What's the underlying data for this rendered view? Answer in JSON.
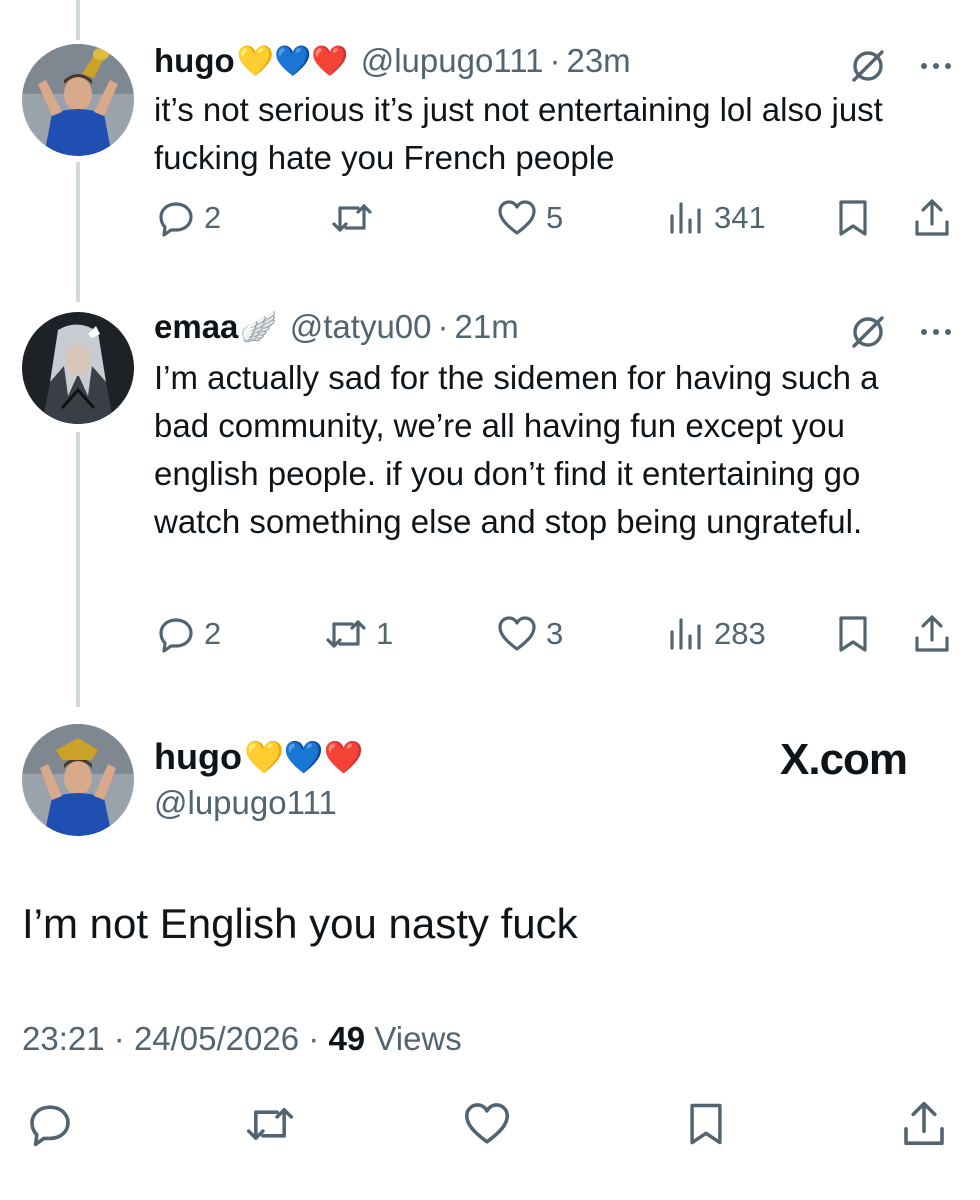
{
  "tweets": [
    {
      "name": "hugo",
      "emojis": "💛💙❤️",
      "handle": "@lupugo111",
      "time": "23m",
      "text": "it’s not serious it’s just not entertaining lol also just fucking hate you French people",
      "replies": "2",
      "retweets": "",
      "likes": "5",
      "views": "341"
    },
    {
      "name": "emaa",
      "emojis": "🪽",
      "handle": "@tatyu00",
      "time": "21m",
      "text": "I’m actually sad for the sidemen for having such a bad community, we’re all having fun except you english people. if you don’t find it entertaining go watch something else and stop being ungrateful.",
      "replies": "2",
      "retweets": "1",
      "likes": "3",
      "views": "283"
    }
  ],
  "main_tweet": {
    "name": "hugo",
    "emojis": "💛💙❤️",
    "handle": "@lupugo111",
    "brand": "X.com",
    "text": "I’m not English you nasty fuck",
    "time": "23:21",
    "date": "24/05/2026",
    "views_count": "49",
    "views_label": "Views"
  },
  "colors": {
    "text": "#0f1419",
    "secondary": "#536471",
    "thread_line": "#cfd9de",
    "background": "#ffffff"
  },
  "icons": [
    "reply-icon",
    "retweet-icon",
    "like-icon",
    "views-icon",
    "bookmark-icon",
    "share-icon",
    "grok-icon",
    "more-icon"
  ]
}
